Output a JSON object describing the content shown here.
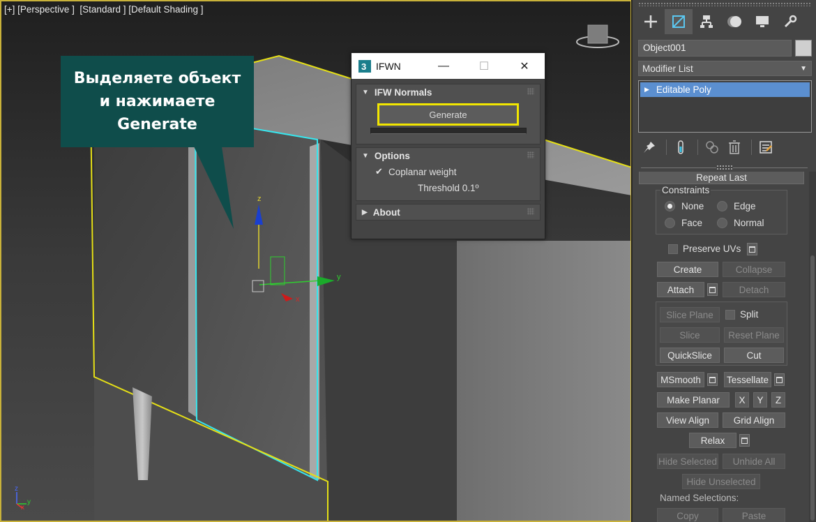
{
  "viewport": {
    "label": "[+] [Perspective ]  [Standard ] [Default Shading ]",
    "gizmo_axes": {
      "x": "x",
      "y": "y",
      "z": "z"
    },
    "corner_axes": {
      "x": "x",
      "y": "y",
      "z": "z"
    }
  },
  "callout": {
    "line1": "Выделяете объект",
    "line2": "и нажимаете",
    "line3": "Generate"
  },
  "ifwn_dialog": {
    "title": "IFWN",
    "minimize": "—",
    "maximize": "☐",
    "close": "✕",
    "rollouts": {
      "normals": {
        "title": "IFW Normals",
        "generate_label": "Generate",
        "progress": 0
      },
      "options": {
        "title": "Options",
        "coplanar_label": "Coplanar weight",
        "coplanar_checked": true,
        "threshold_label": "Threshold 0.1º"
      },
      "about": {
        "title": "About"
      }
    }
  },
  "command_panel": {
    "tabs": [
      "create",
      "modify",
      "hierarchy",
      "motion",
      "display",
      "utilities"
    ],
    "active_tab": "modify",
    "object_name": "Object001",
    "object_color": "#cfcfcf",
    "modifier_list_label": "Modifier List",
    "stack": [
      {
        "label": "Editable Poly",
        "selected": true
      }
    ],
    "edit_geometry": {
      "repeat_last": "Repeat Last",
      "constraints": {
        "title": "Constraints",
        "options": [
          "None",
          "Edge",
          "Face",
          "Normal"
        ],
        "selected": "None"
      },
      "preserve_uvs": "Preserve UVs",
      "create": "Create",
      "collapse": "Collapse",
      "attach": "Attach",
      "detach": "Detach",
      "slice_plane": "Slice Plane",
      "split": "Split",
      "slice": "Slice",
      "reset_plane": "Reset Plane",
      "quickslice": "QuickSlice",
      "cut": "Cut",
      "msmooth": "MSmooth",
      "tessellate": "Tessellate",
      "make_planar": "Make Planar",
      "x": "X",
      "y": "Y",
      "z": "Z",
      "view_align": "View Align",
      "grid_align": "Grid Align",
      "relax": "Relax",
      "hide_selected": "Hide Selected",
      "unhide_all": "Unhide All",
      "hide_unselected": "Hide Unselected",
      "named_selections": "Named Selections:",
      "copy": "Copy",
      "paste": "Paste"
    }
  },
  "colors": {
    "highlight_yellow": "#f2e600",
    "selection_cyan": "#37e6ee",
    "callout_bg": "#0f4d4b",
    "stack_selected": "#5b8fd0"
  }
}
